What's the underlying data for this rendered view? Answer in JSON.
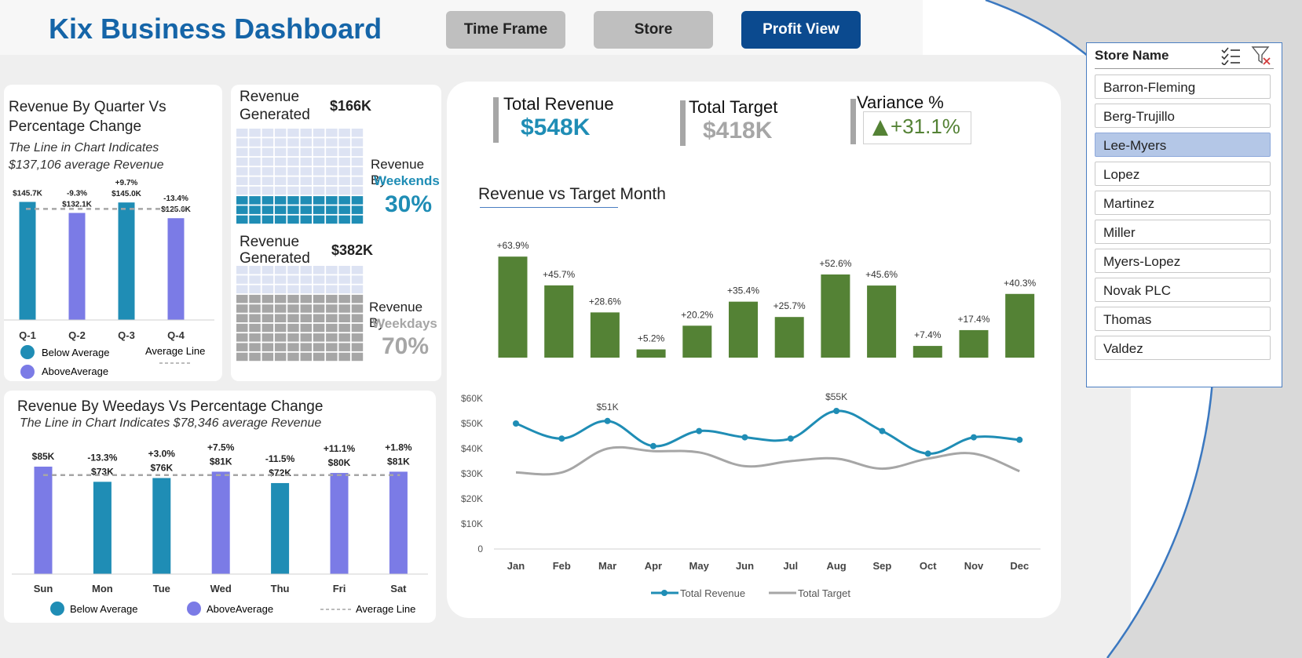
{
  "header": {
    "title": "Kix Business Dashboard"
  },
  "nav": {
    "time_frame": "Time Frame",
    "store": "Store",
    "profit_view": "Profit View"
  },
  "colors": {
    "teal": "#1f8db5",
    "purple": "#7b7be6",
    "green": "#548235",
    "gray": "#a6a6a6",
    "navy": "#0b4a8f",
    "title_blue": "#1565a8"
  },
  "quarter_panel": {
    "title_line1": "Revenue By Quarter Vs",
    "title_line2": "Percentage Change",
    "note_line1": "The Line in Chart Indicates",
    "note_line2": "$137,106 average Revenue",
    "legend_below": "Below Average",
    "legend_above": "AboveAverage",
    "legend_line": "Average Line"
  },
  "waffle_panel": {
    "weekend_label1": "Revenue",
    "weekend_label2": "Generated",
    "weekend_value": "$166K",
    "weekend_caption1": "Revenue By",
    "weekend_caption2": "Weekends",
    "weekend_pct": "30%",
    "weekday_label1": "Revenue",
    "weekday_label2": "Generated",
    "weekday_value": "$382K",
    "weekday_caption1": "Revenue By",
    "weekday_caption2": "Weekdays",
    "weekday_pct": "70%"
  },
  "kpis": {
    "total_revenue_label": "Total Revenue",
    "total_revenue_value": "$548K",
    "total_target_label": "Total Target",
    "total_target_value": "$418K",
    "variance_label": "Variance %",
    "variance_value": "+31.1%"
  },
  "monthly_panel": {
    "title": "Revenue vs Target Month",
    "legend_revenue": "Total Revenue",
    "legend_target": "Total Target"
  },
  "weekday_panel": {
    "title": "Revenue By Weedays Vs Percentage Change",
    "note": "The Line in Chart Indicates $78,346 average Revenue",
    "legend_below": "Below Average",
    "legend_above": "AboveAverage",
    "legend_line": "Average Line"
  },
  "slicer": {
    "title": "Store Name",
    "items": [
      "Barron-Fleming",
      "Berg-Trujillo",
      "Lee-Myers",
      "Lopez",
      "Martinez",
      "Miller",
      "Myers-Lopez",
      "Novak PLC",
      "Thomas",
      "Valdez"
    ],
    "selected": "Lee-Myers"
  },
  "chart_data": [
    {
      "type": "bar",
      "id": "quarter",
      "categories": [
        "Q-1",
        "Q-2",
        "Q-3",
        "Q-4"
      ],
      "values": [
        145.7,
        132.1,
        145.0,
        125.6
      ],
      "value_labels": [
        "$145.7K",
        "$132.1K",
        "$145.0K",
        "$125.6K"
      ],
      "pct_labels": [
        "",
        "-9.3%",
        "+9.7%",
        "-13.4%"
      ],
      "colors": [
        "teal",
        "purple",
        "teal",
        "purple"
      ],
      "average": 137.106,
      "ylim": [
        0,
        150
      ]
    },
    {
      "type": "bar",
      "id": "weekday",
      "categories": [
        "Sun",
        "Mon",
        "Tue",
        "Wed",
        "Thu",
        "Fri",
        "Sat"
      ],
      "values": [
        85,
        73,
        76,
        81,
        72,
        80,
        81
      ],
      "value_labels": [
        "$85K",
        "$73K",
        "$76K",
        "$81K",
        "$72K",
        "$80K",
        "$81K"
      ],
      "pct_labels": [
        "",
        "-13.3%",
        "+3.0%",
        "+7.5%",
        "-11.5%",
        "+11.1%",
        "+1.8%"
      ],
      "colors": [
        "purple",
        "teal",
        "teal",
        "purple",
        "teal",
        "purple",
        "purple"
      ],
      "average": 78.346,
      "ylim": [
        0,
        85
      ]
    },
    {
      "type": "bar",
      "id": "variance",
      "categories": [
        "Jan",
        "Feb",
        "Mar",
        "Apr",
        "May",
        "Jun",
        "Jul",
        "Aug",
        "Sep",
        "Oct",
        "Nov",
        "Dec"
      ],
      "values": [
        63.9,
        45.7,
        28.6,
        5.2,
        20.2,
        35.4,
        25.7,
        52.6,
        45.6,
        7.4,
        17.4,
        40.3
      ],
      "value_labels": [
        "+63.9%",
        "+45.7%",
        "+28.6%",
        "+5.2%",
        "+20.2%",
        "+35.4%",
        "+25.7%",
        "+52.6%",
        "+45.6%",
        "+7.4%",
        "+17.4%",
        "+40.3%"
      ],
      "ylim": [
        0,
        64
      ]
    },
    {
      "type": "line",
      "id": "monthly",
      "categories": [
        "Jan",
        "Feb",
        "Mar",
        "Apr",
        "May",
        "Jun",
        "Jul",
        "Aug",
        "Sep",
        "Oct",
        "Nov",
        "Dec"
      ],
      "series": [
        {
          "name": "Total Revenue",
          "values": [
            50,
            44,
            51,
            41,
            47,
            44.5,
            44,
            55,
            47,
            38,
            44.5,
            43.5
          ]
        },
        {
          "name": "Total Target",
          "values": [
            30.5,
            30.5,
            40,
            39,
            38.5,
            33,
            35,
            36,
            32,
            36,
            38,
            31
          ]
        }
      ],
      "point_labels": [
        {
          "index": 2,
          "label": "$51K"
        },
        {
          "index": 7,
          "label": "$55K"
        }
      ],
      "y_ticks": [
        "0",
        "$10K",
        "$20K",
        "$30K",
        "$40K",
        "$50K",
        "$60K"
      ],
      "ylim": [
        0,
        60
      ]
    }
  ]
}
